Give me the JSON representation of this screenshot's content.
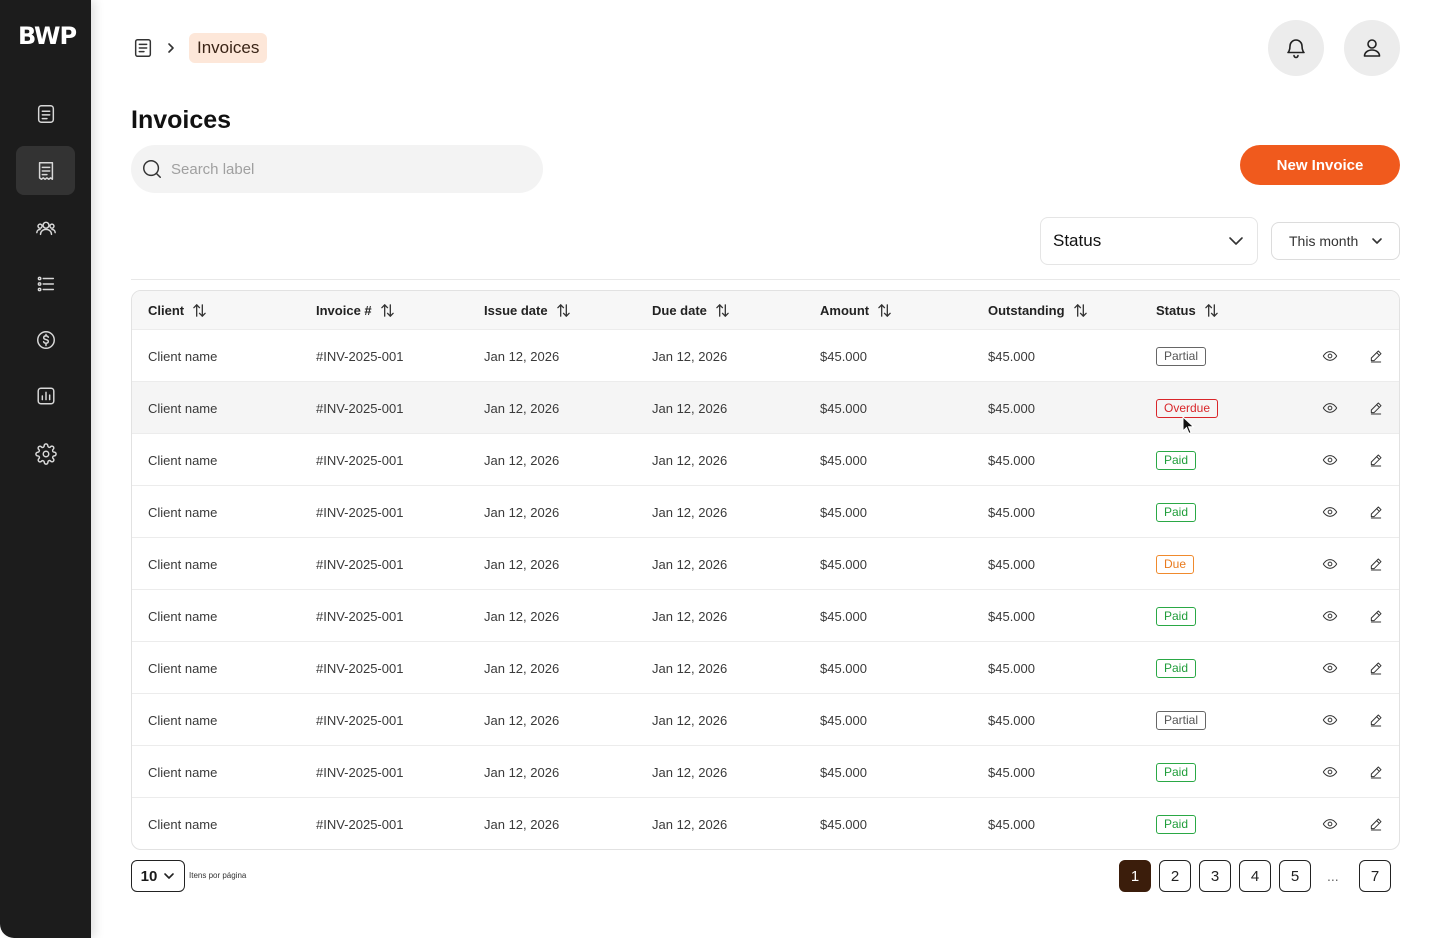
{
  "sidebar": {
    "logo": "BWP",
    "items": [
      {
        "icon": "document-icon",
        "active": false
      },
      {
        "icon": "invoice-icon",
        "active": true
      },
      {
        "icon": "users-icon",
        "active": false
      },
      {
        "icon": "list-icon",
        "active": false
      },
      {
        "icon": "dollar-icon",
        "active": false
      },
      {
        "icon": "report-icon",
        "active": false
      },
      {
        "icon": "gear-icon",
        "active": false
      }
    ]
  },
  "header": {
    "breadcrumb_current": "Invoices",
    "breadcrumb_home_icon": "invoice-icon",
    "notification_icon": "bell-icon",
    "profile_icon": "user-icon"
  },
  "main": {
    "title": "Invoices",
    "search_placeholder": "Search label",
    "new_invoice_label": "New Invoice",
    "status_filter": "Status",
    "period_filter": "This month"
  },
  "table": {
    "columns": [
      "Client",
      "Invoice #",
      "Issue date",
      "Due date",
      "Amount",
      "Outstanding",
      "Status"
    ],
    "rows": [
      {
        "client": "Client name",
        "invoice": "#INV-2025-001",
        "issue": "Jan 12, 2026",
        "due": "Jan 12, 2026",
        "amount": "$45.000",
        "outstanding": "$45.000",
        "status": "Partial",
        "kind": "partial"
      },
      {
        "client": "Client name",
        "invoice": "#INV-2025-001",
        "issue": "Jan 12, 2026",
        "due": "Jan 12, 2026",
        "amount": "$45.000",
        "outstanding": "$45.000",
        "status": "Overdue",
        "kind": "overdue"
      },
      {
        "client": "Client name",
        "invoice": "#INV-2025-001",
        "issue": "Jan 12, 2026",
        "due": "Jan 12, 2026",
        "amount": "$45.000",
        "outstanding": "$45.000",
        "status": "Paid",
        "kind": "paid"
      },
      {
        "client": "Client name",
        "invoice": "#INV-2025-001",
        "issue": "Jan 12, 2026",
        "due": "Jan 12, 2026",
        "amount": "$45.000",
        "outstanding": "$45.000",
        "status": "Paid",
        "kind": "paid"
      },
      {
        "client": "Client name",
        "invoice": "#INV-2025-001",
        "issue": "Jan 12, 2026",
        "due": "Jan 12, 2026",
        "amount": "$45.000",
        "outstanding": "$45.000",
        "status": "Due",
        "kind": "due"
      },
      {
        "client": "Client name",
        "invoice": "#INV-2025-001",
        "issue": "Jan 12, 2026",
        "due": "Jan 12, 2026",
        "amount": "$45.000",
        "outstanding": "$45.000",
        "status": "Paid",
        "kind": "paid"
      },
      {
        "client": "Client name",
        "invoice": "#INV-2025-001",
        "issue": "Jan 12, 2026",
        "due": "Jan 12, 2026",
        "amount": "$45.000",
        "outstanding": "$45.000",
        "status": "Paid",
        "kind": "paid"
      },
      {
        "client": "Client name",
        "invoice": "#INV-2025-001",
        "issue": "Jan 12, 2026",
        "due": "Jan 12, 2026",
        "amount": "$45.000",
        "outstanding": "$45.000",
        "status": "Partial",
        "kind": "partial"
      },
      {
        "client": "Client name",
        "invoice": "#INV-2025-001",
        "issue": "Jan 12, 2026",
        "due": "Jan 12, 2026",
        "amount": "$45.000",
        "outstanding": "$45.000",
        "status": "Paid",
        "kind": "paid"
      },
      {
        "client": "Client name",
        "invoice": "#INV-2025-001",
        "issue": "Jan 12, 2026",
        "due": "Jan 12, 2026",
        "amount": "$45.000",
        "outstanding": "$45.000",
        "status": "Paid",
        "kind": "paid"
      }
    ],
    "row_actions": [
      "eye-icon",
      "pencil-icon"
    ]
  },
  "pagination": {
    "per_page": "10",
    "per_page_label": "Itens por página",
    "pages": [
      "1",
      "2",
      "3",
      "4",
      "5"
    ],
    "ellipsis": "...",
    "last_page": "7",
    "current": "1"
  },
  "colors": {
    "accent": "#f05a1d",
    "sidebar": "#1c1c1c",
    "active_page": "#3b1d0b",
    "breadcrumb_bg": "#fde7d9",
    "paid": "#1f9d3a",
    "overdue": "#d9262a",
    "due": "#e97a1d",
    "partial": "#555555"
  }
}
